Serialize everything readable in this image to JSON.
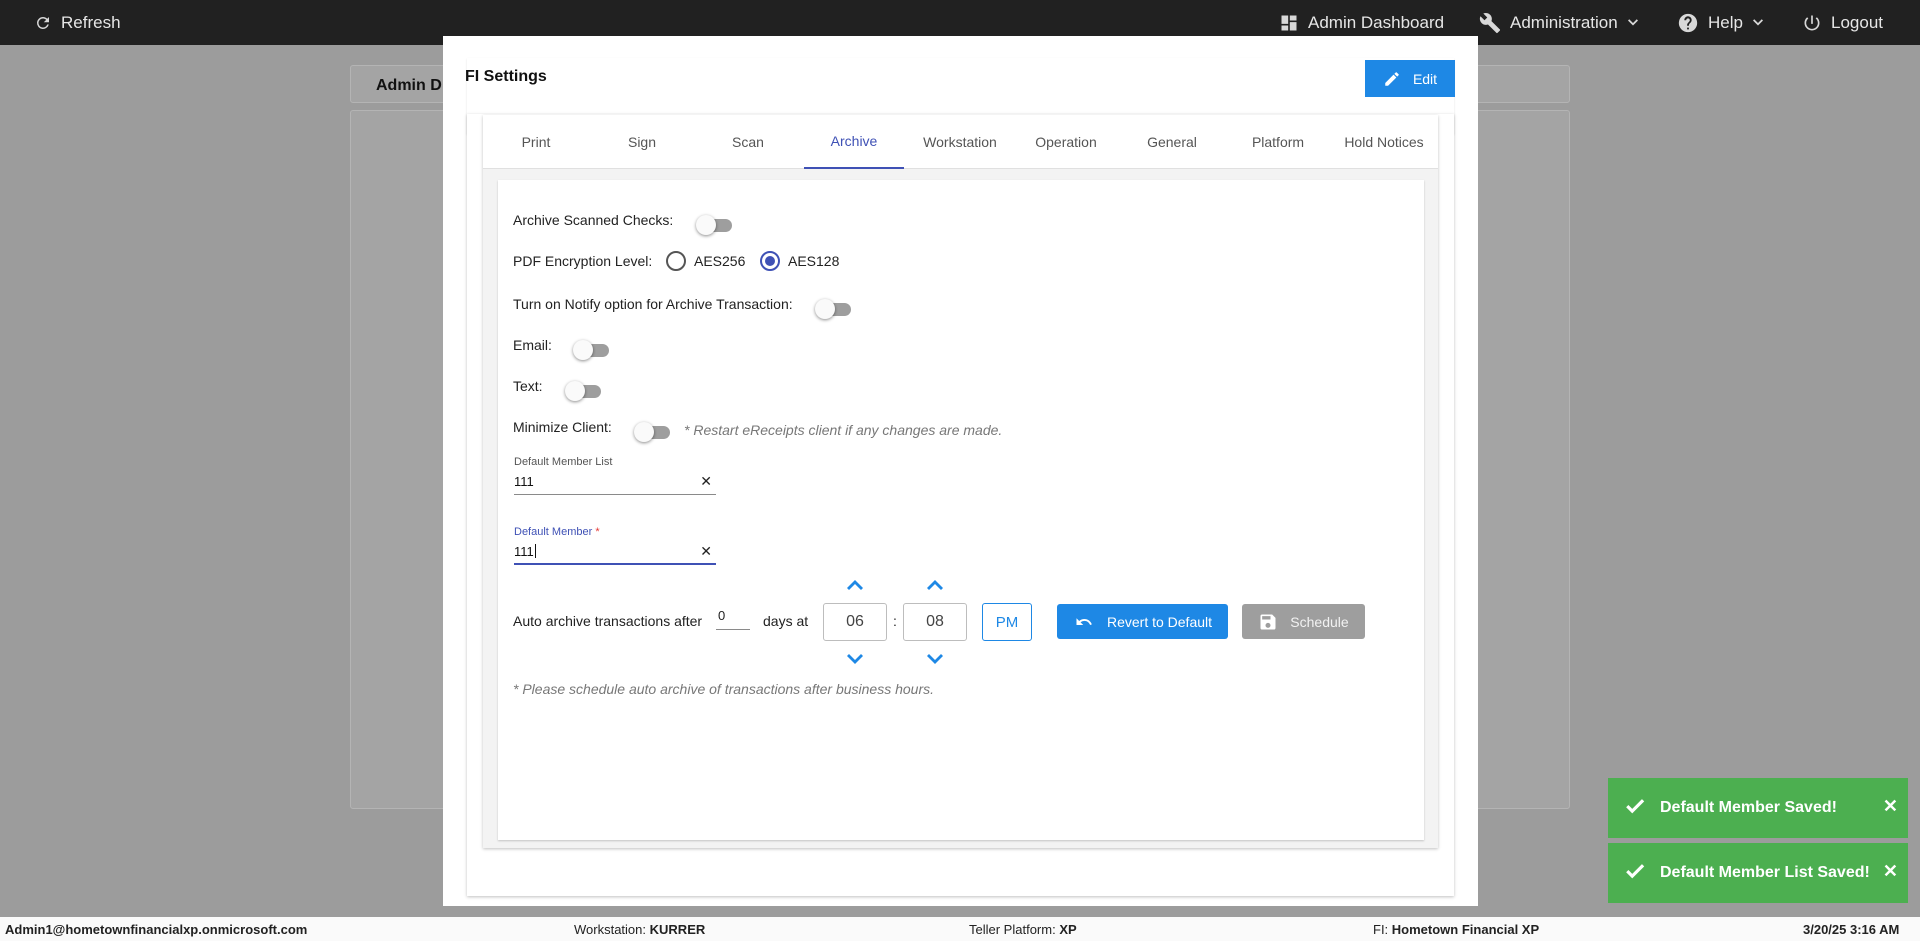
{
  "topbar": {
    "refresh_label": "Refresh",
    "admin_dashboard_label": "Admin Dashboard",
    "administration_label": "Administration",
    "help_label": "Help",
    "logout_label": "Logout"
  },
  "background": {
    "tab_label": "Admin D"
  },
  "modal": {
    "title": "FI Settings",
    "edit_label": "Edit",
    "tabs": [
      {
        "label": "Print"
      },
      {
        "label": "Sign"
      },
      {
        "label": "Scan"
      },
      {
        "label": "Archive",
        "active": true
      },
      {
        "label": "Workstation"
      },
      {
        "label": "Operation"
      },
      {
        "label": "General"
      },
      {
        "label": "Platform"
      },
      {
        "label": "Hold Notices"
      }
    ]
  },
  "archive": {
    "archive_scanned_checks_label": "Archive Scanned Checks:",
    "archive_scanned_checks_on": false,
    "pdf_encryption_label": "PDF Encryption Level:",
    "encryption_options": [
      "AES256",
      "AES128"
    ],
    "encryption_selected": "AES128",
    "notify_label": "Turn on Notify option for Archive Transaction:",
    "notify_on": false,
    "email_label": "Email:",
    "email_on": false,
    "text_label": "Text:",
    "text_on": false,
    "minimize_label": "Minimize Client:",
    "minimize_on": false,
    "restart_note": "* Restart eReceipts client if any changes are made.",
    "default_member_list_label": "Default Member List",
    "default_member_list_value": "111",
    "default_member_label": "Default Member",
    "default_member_required": "*",
    "default_member_value": "111",
    "auto_archive_label": "Auto archive transactions after",
    "days_value": "0",
    "days_at_label": "days at",
    "hour": "06",
    "minute": "08",
    "time_separator": ":",
    "ampm": "PM",
    "revert_label": "Revert to Default",
    "schedule_label": "Schedule",
    "schedule_note": "* Please schedule auto archive of transactions after business hours."
  },
  "toasts": [
    {
      "message": "Default Member Saved!"
    },
    {
      "message": "Default Member List Saved!"
    }
  ],
  "statusbar": {
    "user": "Admin1@hometownfinancialxp.onmicrosoft.com",
    "workstation_label": "Workstation:",
    "workstation_value": "KURRER",
    "teller_platform_label": "Teller Platform:",
    "teller_platform_value": "XP",
    "fi_label": "FI:",
    "fi_value": "Hometown Financial XP",
    "datetime": "3/20/25 3:16 AM"
  },
  "colors": {
    "primary": "#1e88e5",
    "tab_active": "#3f51b5",
    "toast_success": "#4caf50",
    "topbar": "#212121"
  }
}
